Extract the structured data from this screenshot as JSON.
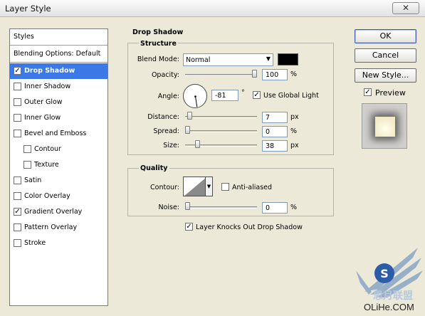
{
  "window": {
    "title": "Layer Style",
    "close_glyph": "✕"
  },
  "left_panel": {
    "header": "Styles",
    "blending_options": "Blending Options: Default",
    "items": [
      {
        "label": "Drop Shadow",
        "checked": true,
        "selected": true,
        "indent": false
      },
      {
        "label": "Inner Shadow",
        "checked": false,
        "selected": false,
        "indent": false
      },
      {
        "label": "Outer Glow",
        "checked": false,
        "selected": false,
        "indent": false
      },
      {
        "label": "Inner Glow",
        "checked": false,
        "selected": false,
        "indent": false
      },
      {
        "label": "Bevel and Emboss",
        "checked": false,
        "selected": false,
        "indent": false
      },
      {
        "label": "Contour",
        "checked": false,
        "selected": false,
        "indent": true
      },
      {
        "label": "Texture",
        "checked": false,
        "selected": false,
        "indent": true
      },
      {
        "label": "Satin",
        "checked": false,
        "selected": false,
        "indent": false
      },
      {
        "label": "Color Overlay",
        "checked": false,
        "selected": false,
        "indent": false
      },
      {
        "label": "Gradient Overlay",
        "checked": true,
        "selected": false,
        "indent": false
      },
      {
        "label": "Pattern Overlay",
        "checked": false,
        "selected": false,
        "indent": false
      },
      {
        "label": "Stroke",
        "checked": false,
        "selected": false,
        "indent": false
      }
    ]
  },
  "drop_shadow": {
    "title": "Drop Shadow",
    "structure": {
      "title": "Structure",
      "blend_mode_label": "Blend Mode:",
      "blend_mode_value": "Normal",
      "shadow_color": "#000000",
      "opacity_label": "Opacity:",
      "opacity_value": "100",
      "opacity_unit": "%",
      "opacity_fraction": 1.0,
      "angle_label": "Angle:",
      "angle_value": "-81",
      "angle_unit": "°",
      "use_global_light_label": "Use Global Light",
      "use_global_light_checked": true,
      "distance_label": "Distance:",
      "distance_value": "7",
      "distance_unit": "px",
      "distance_fraction": 0.03,
      "spread_label": "Spread:",
      "spread_value": "0",
      "spread_unit": "%",
      "spread_fraction": 0.0,
      "size_label": "Size:",
      "size_value": "38",
      "size_unit": "px",
      "size_fraction": 0.15
    },
    "quality": {
      "title": "Quality",
      "contour_label": "Contour:",
      "anti_aliased_label": "Anti-aliased",
      "anti_aliased_checked": false,
      "noise_label": "Noise:",
      "noise_value": "0",
      "noise_unit": "%",
      "noise_fraction": 0.0
    },
    "knocks_out_label": "Layer Knocks Out Drop Shadow",
    "knocks_out_checked": true
  },
  "buttons": {
    "ok": "OK",
    "cancel": "Cancel",
    "new_style": "New Style...",
    "preview_label": "Preview",
    "preview_checked": true
  },
  "watermark": {
    "text": "OLiHe.COM",
    "emblem_text": "S",
    "emblem_caption": "思月联盟"
  },
  "colors": {
    "selection": "#3c78e6",
    "dialog_bg": "#ece9d8"
  }
}
